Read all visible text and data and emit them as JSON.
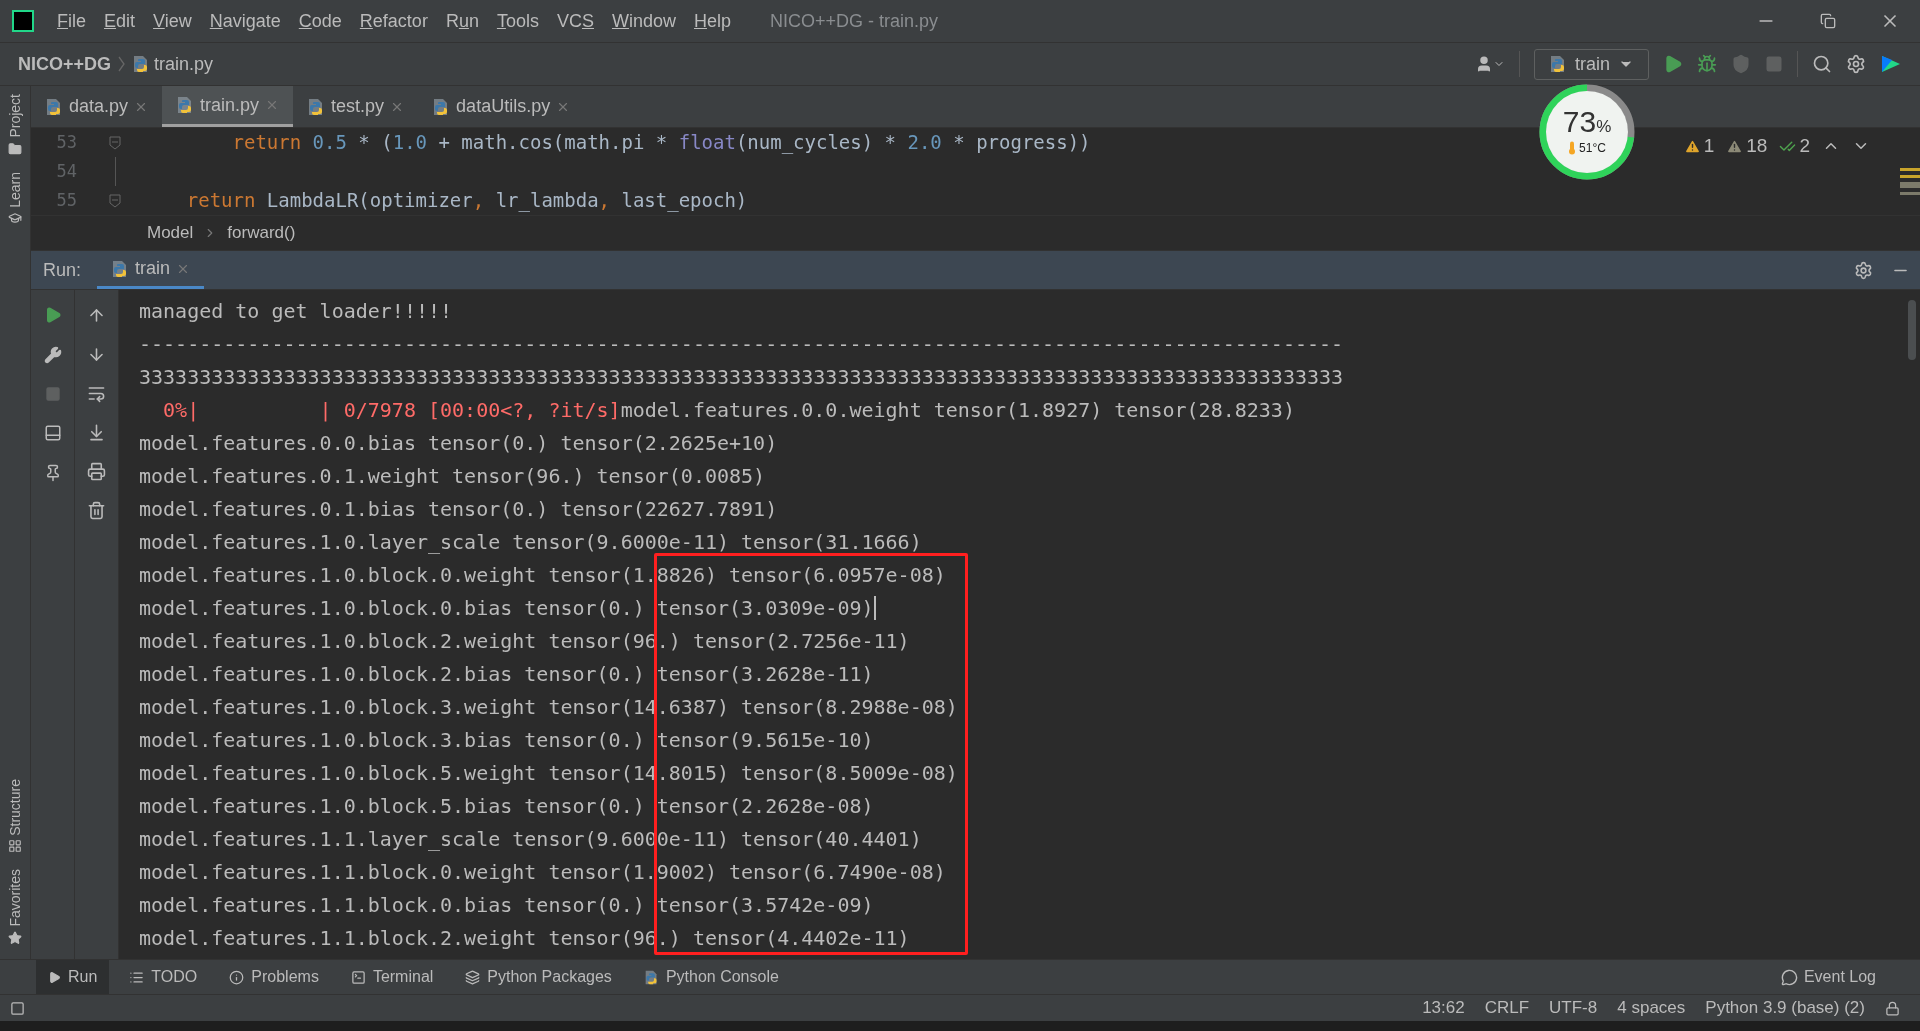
{
  "window": {
    "title": "NICO++DG - train.py"
  },
  "menu": [
    {
      "key": "F",
      "after": "ile"
    },
    {
      "key": "E",
      "after": "dit"
    },
    {
      "key": "V",
      "after": "iew"
    },
    {
      "key": "N",
      "after": "avigate"
    },
    {
      "key": "C",
      "after": "ode"
    },
    {
      "key": "R",
      "after": "efactor"
    },
    {
      "before": "R",
      "key": "u",
      "after": "n"
    },
    {
      "key": "T",
      "after": "ools"
    },
    {
      "before": "VC",
      "key": "S"
    },
    {
      "key": "W",
      "after": "indow"
    },
    {
      "key": "H",
      "after": "elp"
    }
  ],
  "navbar": {
    "project": "NICO++DG",
    "file": "train.py",
    "run_config": "train"
  },
  "left_stripe": {
    "top": [
      "Project",
      "Learn"
    ],
    "bottom": [
      "Structure",
      "Favorites"
    ]
  },
  "editor_tabs": [
    {
      "label": "data.py",
      "selected": false
    },
    {
      "label": "train.py",
      "selected": true
    },
    {
      "label": "test.py",
      "selected": false
    },
    {
      "label": "dataUtils.py",
      "selected": false
    }
  ],
  "editor": {
    "lines": [
      {
        "number": "53",
        "fold": true,
        "tokens": [
          {
            "text": "        return",
            "kind": "keyword"
          },
          {
            "text": " 0.5",
            "kind": "number"
          },
          {
            "text": " * (",
            "kind": "plain"
          },
          {
            "text": "1.0",
            "kind": "number"
          },
          {
            "text": " + math.cos(math.pi * ",
            "kind": "plain"
          },
          {
            "text": "float",
            "kind": "builtin"
          },
          {
            "text": "(num_cycles) * ",
            "kind": "plain"
          },
          {
            "text": "2.0",
            "kind": "number"
          },
          {
            "text": " * progress))",
            "kind": "plain"
          }
        ]
      },
      {
        "number": "54",
        "fold": false
      },
      {
        "number": "55",
        "fold": true,
        "tokens": [
          {
            "text": "    return",
            "kind": "keyword"
          },
          {
            "text": " LambdaLR(optimizer",
            "kind": "plain"
          },
          {
            "text": ",",
            "kind": "keyword"
          },
          {
            "text": " lr_lambda",
            "kind": "plain"
          },
          {
            "text": ",",
            "kind": "keyword"
          },
          {
            "text": " last_epoch)",
            "kind": "plain"
          }
        ]
      }
    ],
    "inspections": [
      {
        "kind": "warning",
        "count": "1"
      },
      {
        "kind": "weak_warning",
        "count": "18"
      },
      {
        "kind": "typo",
        "count": "2"
      }
    ]
  },
  "breadcrumb": [
    "Model",
    "forward()"
  ],
  "gauge": {
    "value": "73",
    "unit": "%",
    "temperature": "51°C",
    "level": 0.73
  },
  "run_panel": {
    "label": "Run:",
    "tab": "train",
    "lines": [
      {
        "text": "managed to get loader!!!!!",
        "cursor": false
      },
      {
        "text": "----------------------------------------------------------------------------------------------------",
        "cursor": false
      },
      {
        "text": "3333333333333333333333333333333333333333333333333333333333333333333333333333333333333333333333333333",
        "cursor": false
      },
      {
        "stderr": "  0%|          | 0/7978 [00:00<?, ?it/s]",
        "text": "model.features.0.0.weight tensor(1.8927) tensor(28.8233)",
        "cursor": false
      },
      {
        "text": "model.features.0.0.bias tensor(0.) tensor(2.2625e+10)",
        "cursor": false
      },
      {
        "text": "model.features.0.1.weight tensor(96.) tensor(0.0085)",
        "cursor": false
      },
      {
        "text": "model.features.0.1.bias tensor(0.) tensor(22627.7891)",
        "cursor": false
      },
      {
        "text": "model.features.1.0.layer_scale tensor(9.6000e-11) tensor(31.1666)",
        "cursor": false
      },
      {
        "text": "model.features.1.0.block.0.weight tensor(1.8826) tensor(6.0957e-08)",
        "cursor": false
      },
      {
        "text": "model.features.1.0.block.0.bias tensor(0.) tensor(3.0309e-09)",
        "cursor": true
      },
      {
        "text": "model.features.1.0.block.2.weight tensor(96.) tensor(2.7256e-11)",
        "cursor": false
      },
      {
        "text": "model.features.1.0.block.2.bias tensor(0.) tensor(3.2628e-11)",
        "cursor": false
      },
      {
        "text": "model.features.1.0.block.3.weight tensor(14.6387) tensor(8.2988e-08)",
        "cursor": false
      },
      {
        "text": "model.features.1.0.block.3.bias tensor(0.) tensor(9.5615e-10)",
        "cursor": false
      },
      {
        "text": "model.features.1.0.block.5.weight tensor(14.8015) tensor(8.5009e-08)",
        "cursor": false
      },
      {
        "text": "model.features.1.0.block.5.bias tensor(0.) tensor(2.2628e-08)",
        "cursor": false
      },
      {
        "text": "model.features.1.1.layer_scale tensor(9.6000e-11) tensor(40.4401)",
        "cursor": false
      },
      {
        "text": "model.features.1.1.block.0.weight tensor(1.9002) tensor(6.7490e-08)",
        "cursor": false
      },
      {
        "text": "model.features.1.1.block.0.bias tensor(0.) tensor(3.5742e-09)",
        "cursor": false
      },
      {
        "text": "model.features.1.1.block.2.weight tensor(96.) tensor(4.4402e-11)",
        "cursor": false
      }
    ]
  },
  "bottom_tabs": [
    {
      "label": "Run",
      "kind": "run",
      "selected": true
    },
    {
      "label": "TODO",
      "kind": "todo",
      "selected": false
    },
    {
      "label": "Problems",
      "kind": "problems",
      "selected": false
    },
    {
      "label": "Terminal",
      "kind": "terminal",
      "selected": false
    },
    {
      "label": "Python Packages",
      "kind": "packages",
      "selected": false
    },
    {
      "label": "Python Console",
      "kind": "console",
      "selected": false
    }
  ],
  "event_log": "Event Log",
  "status_bar": [
    "13:62",
    "CRLF",
    "UTF-8",
    "4 spaces",
    "Python 3.9 (base) (2)"
  ]
}
